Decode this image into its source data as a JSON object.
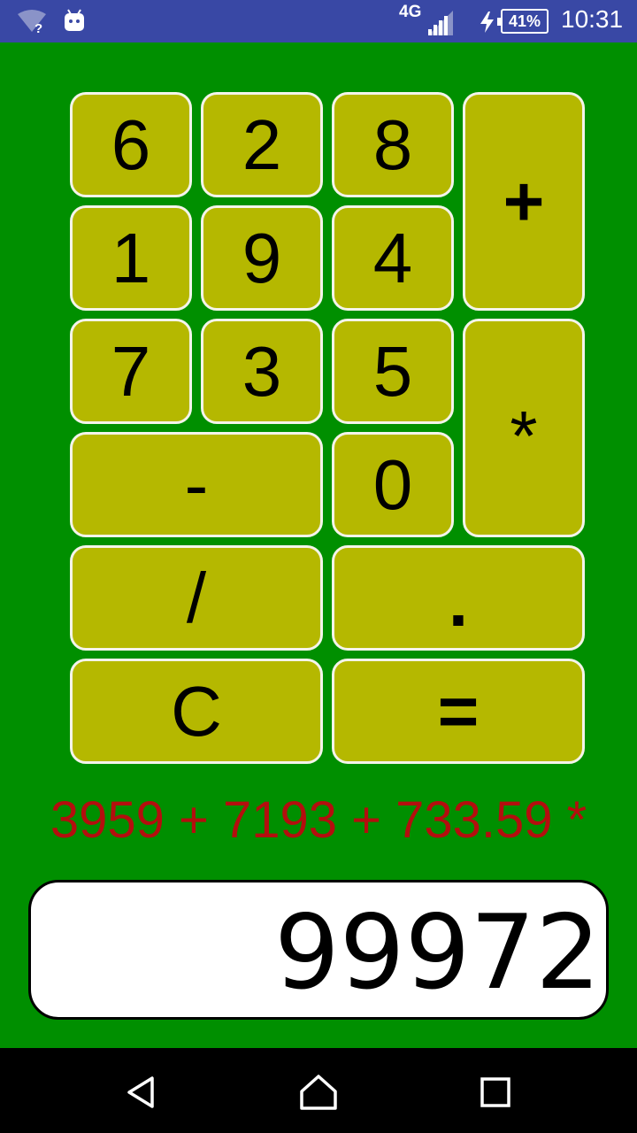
{
  "status_bar": {
    "network": "4G",
    "battery": "41%",
    "time": "10:31",
    "icons": [
      "wifi-unknown-icon",
      "android-debug-icon",
      "signal-icon",
      "charging-icon",
      "battery-icon"
    ]
  },
  "keypad": {
    "keys": [
      "6",
      "2",
      "8",
      "+",
      "1",
      "9",
      "4",
      "7",
      "3",
      "5",
      "*",
      "-",
      "0",
      "/",
      ".",
      "C",
      "="
    ]
  },
  "expression": "3959 + 7193 + 733.59 *",
  "display": {
    "value": "99972"
  },
  "colors": {
    "background": "#008f00",
    "key": "#b5b800",
    "key_border": "#f4f4ea",
    "expression": "#b40e0e",
    "status_bar": "#3948a5"
  },
  "nav_bar": {
    "icons": [
      "back-icon",
      "home-icon",
      "recents-icon"
    ]
  }
}
